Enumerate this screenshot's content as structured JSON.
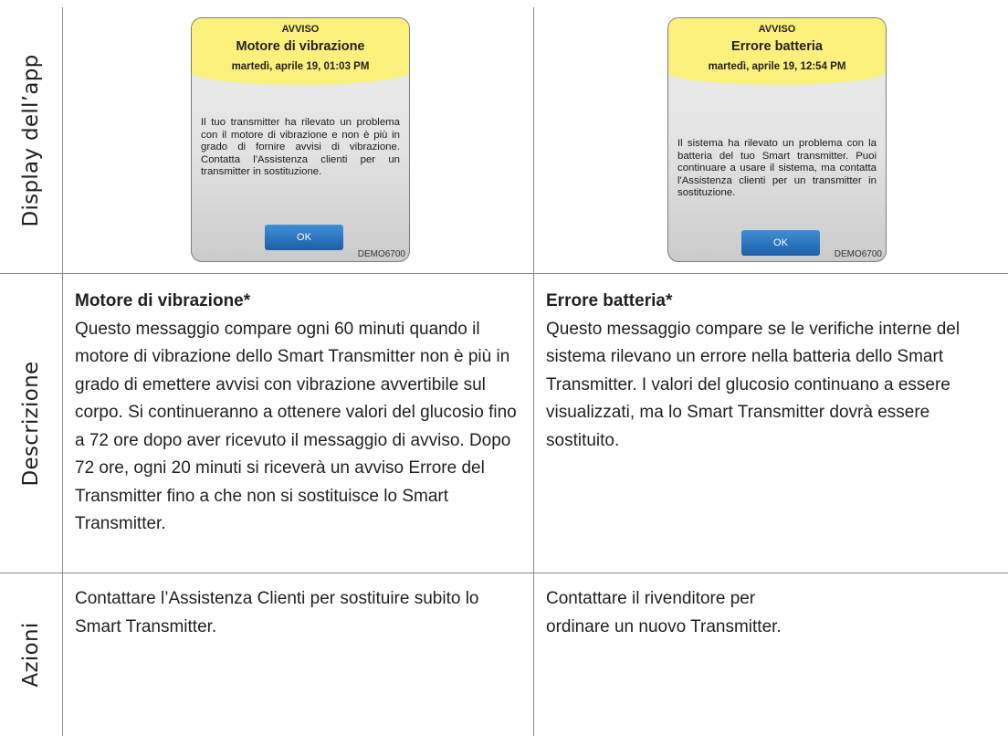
{
  "row_headers": {
    "display": "Display dell’app",
    "description": "Descrizione",
    "actions": "Azioni"
  },
  "columns": [
    {
      "screen": {
        "kind": "AVVISO",
        "name": "Motore di vibrazione",
        "datetime": "martedì, aprile 19, 01:03 PM",
        "message": "Il tuo transmitter ha rilevato un problema con il motore di vibrazione e non è più in grado di fornire avvisi di vibrazione. Contatta l'Assistenza clienti per un transmitter in sostituzione.",
        "ok_label": "OK",
        "demo_label": "DEMO6700"
      },
      "description": {
        "title": "Motore di vibrazione*",
        "text": "Questo messaggio compare ogni 60 minuti quando il motore di vibrazione dello Smart Transmitter non è più in grado di emettere avvisi con vibrazione avvertibile sul corpo. Si continueranno a ottenere valori del glucosio fino a 72 ore dopo aver ricevuto il messaggio di avviso. Dopo 72 ore, ogni 20 minuti si riceverà un avviso Errore del Transmitter fino a che non si sostituisce lo Smart Transmitter."
      },
      "action": "Contattare l’Assistenza Clienti per sostituire subito lo Smart Transmitter."
    },
    {
      "screen": {
        "kind": "AVVISO",
        "name": "Errore batteria",
        "datetime": "martedì, aprile 19, 12:54 PM",
        "message": "Il sistema ha rilevato un problema con la batteria del tuo Smart transmitter. Puoi continuare a usare il sistema, ma contatta l'Assistenza clienti per un transmitter in sostituzione.",
        "ok_label": "OK",
        "demo_label": "DEMO6700"
      },
      "description": {
        "title": "Errore batteria*",
        "text": "Questo messaggio compare se le verifiche interne del sistema rilevano un errore nella batteria dello Smart Transmitter. I valori del glucosio continuano a essere visualizzati, ma lo Smart Transmitter dovrà essere sostituito."
      },
      "action": "Contattare il rivenditore per ordinare un nuovo Transmitter."
    }
  ]
}
